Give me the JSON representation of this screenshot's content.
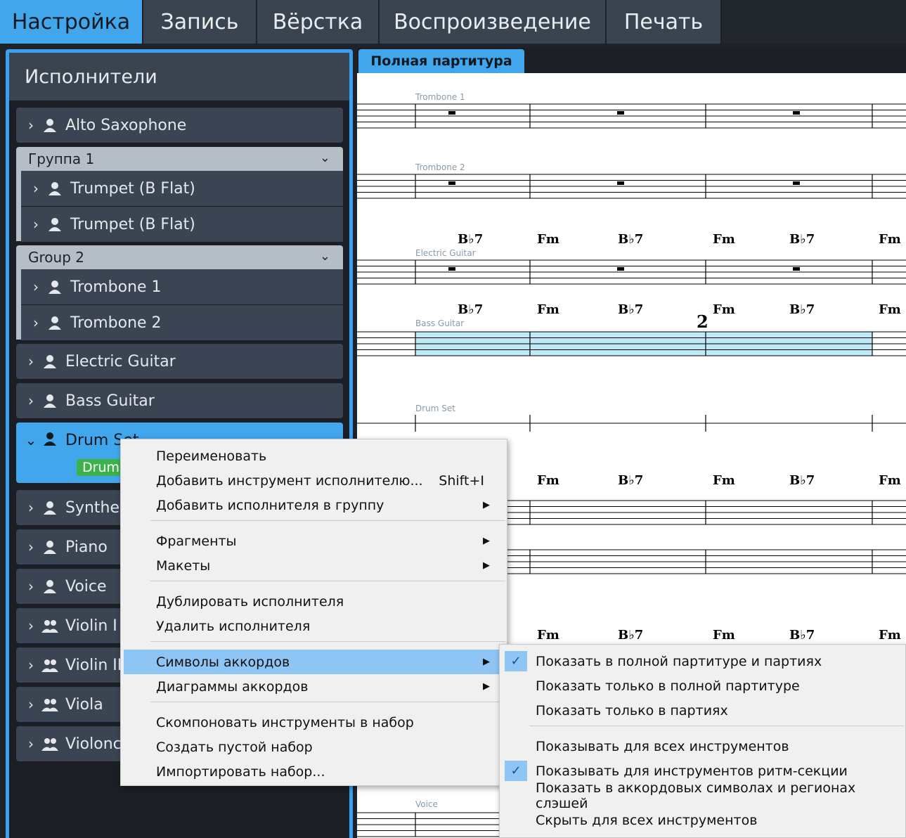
{
  "tabs": [
    "Настройка",
    "Запись",
    "Вёрстка",
    "Воспроизведение",
    "Печать"
  ],
  "panel": {
    "title": "Исполнители",
    "players": [
      "Alto Saxophone",
      "Trumpet (B Flat)",
      "Trumpet (B Flat)",
      "Trombone 1",
      "Trombone 2",
      "Electric Guitar",
      "Bass Guitar",
      "Drum Set",
      "Synthesizer",
      "Piano",
      "Voice",
      "Violin I",
      "Violin II",
      "Viola",
      "Violoncello"
    ],
    "groups": [
      "Группа 1",
      "Group 2"
    ],
    "drum_badge": "Drum Set"
  },
  "score": {
    "tab": "Полная партитура",
    "staff_labels": [
      "Trombone 1",
      "Trombone 2",
      "Electric Guitar",
      "Bass Guitar",
      "Drum Set",
      "Voice"
    ],
    "chords": [
      "Bb7",
      "Fm",
      "Bb7",
      "Fm",
      "Bb7",
      "Fm"
    ],
    "repeat_count": "2"
  },
  "context_menu": {
    "items": [
      {
        "label": "Переименовать"
      },
      {
        "label": "Добавить инструмент исполнителю...",
        "shortcut": "Shift+I"
      },
      {
        "label": "Добавить исполнителя в группу",
        "submenu": true
      },
      {
        "label": "Фрагменты",
        "submenu": true
      },
      {
        "label": "Макеты",
        "submenu": true
      },
      {
        "label": "Дублировать исполнителя"
      },
      {
        "label": "Удалить исполнителя"
      },
      {
        "label": "Символы аккордов",
        "submenu": true,
        "highlighted": true
      },
      {
        "label": "Диаграммы аккордов",
        "submenu": true
      },
      {
        "label": "Скомпоновать инструменты в набор"
      },
      {
        "label": "Создать пустой набор"
      },
      {
        "label": "Импортировать набор..."
      }
    ]
  },
  "submenu": {
    "items": [
      {
        "label": "Показать в полной партитуре и партиях",
        "checked": true
      },
      {
        "label": "Показать только в полной партитуре",
        "checked": false
      },
      {
        "label": "Показать только в партиях",
        "checked": false
      },
      {
        "label": "Показывать для всех инструментов",
        "checked": false
      },
      {
        "label": "Показывать для инструментов ритм-секции",
        "checked": true
      },
      {
        "label": "Показать в аккордовых символах и регионах слэшей",
        "checked": false
      },
      {
        "label": "Скрыть для всех инструментов",
        "checked": false
      }
    ]
  },
  "icons": {
    "chevron_right": "chevron-right-icon",
    "chevron_down": "chevron-down-icon",
    "player": "person-icon",
    "section": "people-icon",
    "check": "check-icon",
    "submenu_arrow": "triangle-right-icon"
  },
  "colors": {
    "accent": "#41a6ec",
    "panel": "#3a4452",
    "selection": "#8ec5f5",
    "badge": "#3bb34a"
  }
}
